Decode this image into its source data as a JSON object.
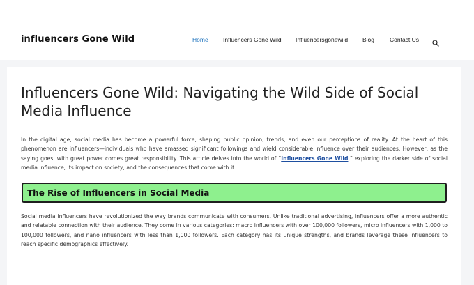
{
  "site": {
    "title": "influencers Gone Wild"
  },
  "nav": {
    "items": [
      {
        "label": "Home",
        "active": true
      },
      {
        "label": "Influencers Gone Wild",
        "active": false
      },
      {
        "label": "Influencersgonewild",
        "active": false
      },
      {
        "label": "Blog",
        "active": false
      },
      {
        "label": "Contact Us",
        "active": false
      }
    ],
    "search_icon": "search-icon"
  },
  "article": {
    "title": "Influencers Gone Wild: Navigating the Wild Side of Social Media Influence",
    "intro_before_link": "In the digital age, social media has become a powerful force, shaping public opinion, trends, and even our perceptions of reality. At the heart of this phenomenon are influencers—individuals who have amassed significant followings and wield considerable influence over their audiences. However, as the saying goes, with great power comes great responsibility. This article delves into the world of “",
    "intro_link": "Influencers Gone Wild",
    "intro_after_link": ",” exploring the darker side of social media influence, its impact on society, and the consequences that come with it.",
    "section_heading": "The Rise of Influencers in Social Media",
    "section_paragraph": "Social media influencers have revolutionized the way brands communicate with consumers. Unlike traditional advertising, influencers offer a more authentic and relatable connection with their audience. They come in various categories: macro influencers with over 100,000 followers, micro influencers with 1,000 to 100,000 followers, and nano influencers with less than 1,000 followers. Each category has its unique strengths, and brands leverage these influencers to reach specific demographics effectively."
  },
  "colors": {
    "accent": "#1e73be",
    "link": "#1e4fa0",
    "heading_bg": "#8ef08e",
    "page_bg": "#f4f5f7"
  }
}
